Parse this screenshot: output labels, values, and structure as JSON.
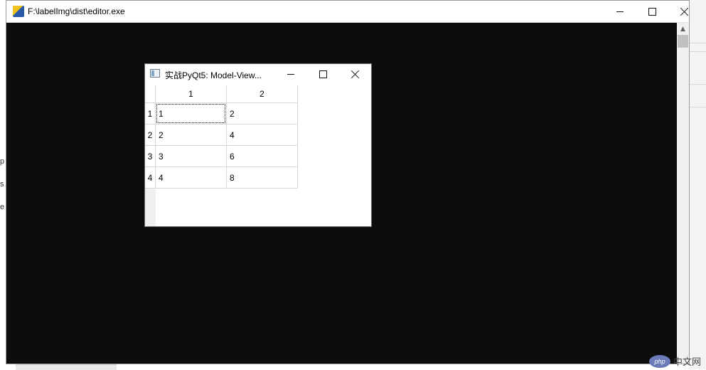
{
  "console": {
    "title": "F:\\labelImg\\dist\\editor.exe"
  },
  "background": {
    "left_fragments": [
      "p",
      "s",
      "e"
    ]
  },
  "dialog": {
    "title": "实战PyQt5: Model-View..."
  },
  "table": {
    "column_headers": [
      "1",
      "2"
    ],
    "row_headers": [
      "1",
      "2",
      "3",
      "4"
    ],
    "rows": [
      [
        "1",
        "2"
      ],
      [
        "2",
        "4"
      ],
      [
        "3",
        "6"
      ],
      [
        "4",
        "8"
      ]
    ],
    "focused_cell": "0,0"
  },
  "watermark": {
    "logo_text": "php",
    "text": "中文网"
  },
  "colors": {
    "console_bg": "#0c0c0c",
    "window_bg": "#ffffff",
    "grid_line": "#d8d8d8"
  }
}
